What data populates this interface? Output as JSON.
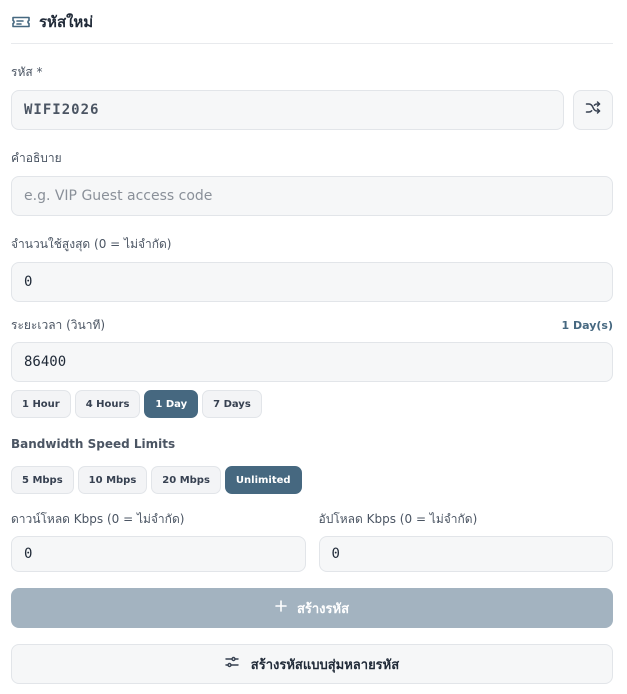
{
  "header": {
    "title": "รหัสใหม่",
    "icon": "ticket-icon"
  },
  "code": {
    "label": "รหัส *",
    "value": "WIFI2026",
    "shuffle_icon": "shuffle-icon"
  },
  "description": {
    "label": "คำอธิบาย",
    "placeholder": "e.g. VIP Guest access code",
    "value": ""
  },
  "max_uses": {
    "label": "จำนวนใช้สูงสุด (0 = ไม่จำกัด)",
    "value": "0"
  },
  "duration": {
    "label": "ระยะเวลา (วินาที)",
    "hint": "1 Day(s)",
    "value": "86400",
    "presets": [
      {
        "label": "1 Hour",
        "active": false
      },
      {
        "label": "4 Hours",
        "active": false
      },
      {
        "label": "1 Day",
        "active": true
      },
      {
        "label": "7 Days",
        "active": false
      }
    ]
  },
  "bandwidth": {
    "title": "Bandwidth Speed Limits",
    "presets": [
      {
        "label": "5 Mbps",
        "active": false
      },
      {
        "label": "10 Mbps",
        "active": false
      },
      {
        "label": "20 Mbps",
        "active": false
      },
      {
        "label": "Unlimited",
        "active": true
      }
    ],
    "download": {
      "label": "ดาวน์โหลด Kbps (0 = ไม่จำกัด)",
      "value": "0"
    },
    "upload": {
      "label": "อัปโหลด Kbps (0 = ไม่จำกัด)",
      "value": "0"
    }
  },
  "actions": {
    "create_label": "สร้างรหัส",
    "create_icon": "plus-icon",
    "bulk_label": "สร้างรหัสแบบสุ่มหลายรหัส",
    "bulk_icon": "sliders-icon"
  },
  "colors": {
    "accent": "#466880",
    "primary_disabled": "#a3b3c0",
    "field_bg": "#f6f7f8",
    "border": "#e2e5e9"
  }
}
